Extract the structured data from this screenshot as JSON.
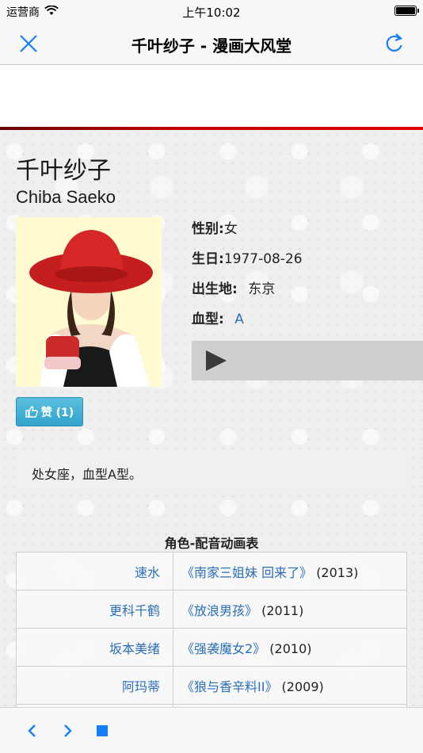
{
  "status_bar": {
    "carrier": "运营商",
    "time": "上午10:02"
  },
  "nav": {
    "title": "千叶纱子 - 漫画大风堂"
  },
  "person": {
    "name_cn": "千叶纱子",
    "name_en": "Chiba Saeko",
    "gender_label": "性别:",
    "gender_value": "女",
    "birthday_label": "生日:",
    "birthday_value": "1977-08-26",
    "birthplace_label": "出生地:",
    "birthplace_value": "东京",
    "blood_label": "血型:",
    "blood_value": "A"
  },
  "like_button": {
    "label": "赞 (1)"
  },
  "description": "处女座，血型A型。",
  "roles": {
    "caption": "角色-配音动画表",
    "rows": [
      {
        "role": "速水",
        "anime": "《南家三姐妹 回来了》",
        "year": "(2013)"
      },
      {
        "role": "更科千鹤",
        "anime": "《放浪男孩》",
        "year": "(2011)"
      },
      {
        "role": "坂本美绪",
        "anime": "《强袭魔女2》",
        "year": "(2010)"
      },
      {
        "role": "阿玛蒂",
        "anime": "《狼与香辛料II》",
        "year": "(2009)"
      }
    ]
  },
  "colors": {
    "accent": "#2a6fb8",
    "ios_blue": "#157efb",
    "banner_red": "#c00000",
    "like_button": "#31a3cc"
  },
  "icons": [
    "wifi-icon",
    "battery-icon",
    "close-icon",
    "reload-icon",
    "play-icon",
    "thumbs-up-icon",
    "back-icon",
    "forward-icon",
    "stop-icon"
  ]
}
